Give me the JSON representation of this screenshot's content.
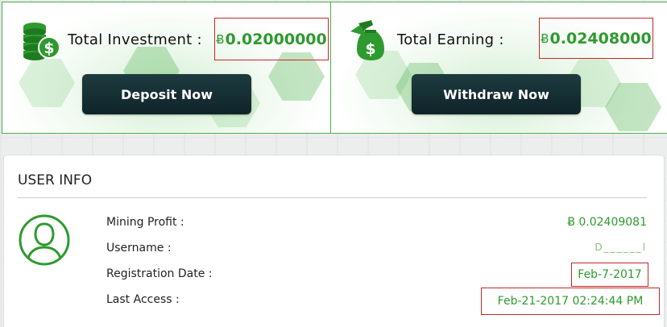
{
  "stats": {
    "investment": {
      "label": "Total Investment :",
      "currency_symbol": "Ƀ",
      "amount": "0.02000000",
      "button_label": "Deposit Now",
      "icon": "coin-stack-dollar-icon"
    },
    "earning": {
      "label": "Total Earning :",
      "currency_symbol": "Ƀ",
      "amount": "0.02408000",
      "button_label": "Withdraw Now",
      "icon": "money-bag-hand-icon"
    }
  },
  "user_info": {
    "title": "USER INFO",
    "avatar_icon": "user-avatar-icon",
    "rows": [
      {
        "label": "Mining Profit :",
        "value": "Ƀ 0.02409081"
      },
      {
        "label": "Username :",
        "value": "D______l"
      },
      {
        "label": "Registration Date :",
        "value": "Feb-7-2017"
      },
      {
        "label": "Last Access :",
        "value": "Feb-21-2017 02:24:44 PM"
      }
    ]
  },
  "colors": {
    "accent_green": "#2e9a2e",
    "button_bg": "#163036",
    "highlight_border": "#c62828"
  }
}
